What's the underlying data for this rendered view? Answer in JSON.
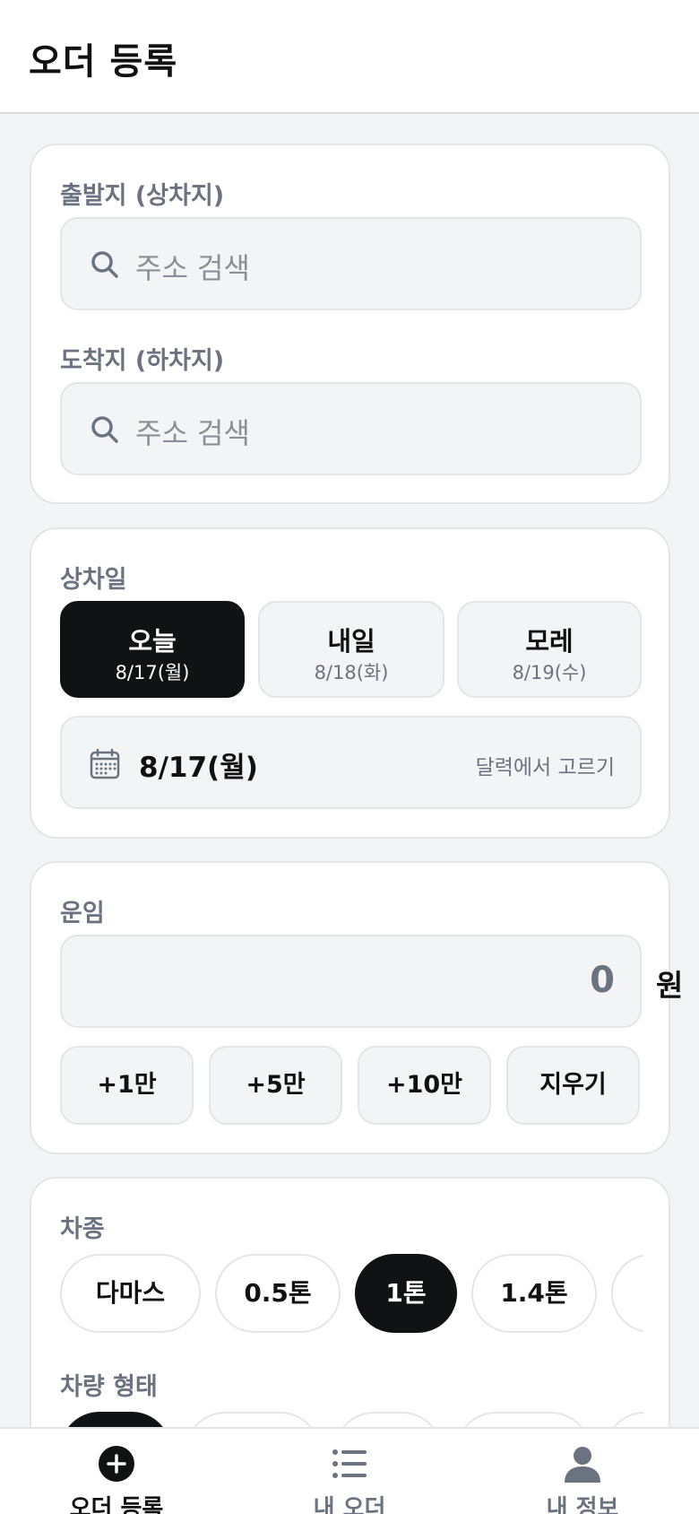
{
  "header": {
    "title": "오더 등록"
  },
  "route": {
    "origin_label": "출발지 (상차지)",
    "origin_placeholder": "주소 검색",
    "dest_label": "도착지 (하차지)",
    "dest_placeholder": "주소 검색"
  },
  "pickup": {
    "label": "상차일",
    "options": [
      {
        "main": "오늘",
        "sub": "8/17(월)",
        "selected": true
      },
      {
        "main": "내일",
        "sub": "8/18(화)",
        "selected": false
      },
      {
        "main": "모레",
        "sub": "8/19(수)",
        "selected": false
      }
    ],
    "selected_date": "8/17(월)",
    "calendar_hint": "달력에서 고르기"
  },
  "fare": {
    "label": "운임",
    "value": "0",
    "unit": "원",
    "quick": [
      "+1만",
      "+5만",
      "+10만",
      "지우기"
    ]
  },
  "vehicle": {
    "type_label": "차종",
    "types": [
      "다마스",
      "0.5톤",
      "1톤",
      "1.4톤"
    ],
    "selected_type": "1톤",
    "shape_label": "차량 형태"
  },
  "tabbar": {
    "tabs": [
      {
        "label": "오더 등록",
        "icon": "plus-circle-icon",
        "active": true
      },
      {
        "label": "내 오더",
        "icon": "list-icon",
        "active": false
      },
      {
        "label": "내 정보",
        "icon": "user-icon",
        "active": false
      }
    ]
  }
}
